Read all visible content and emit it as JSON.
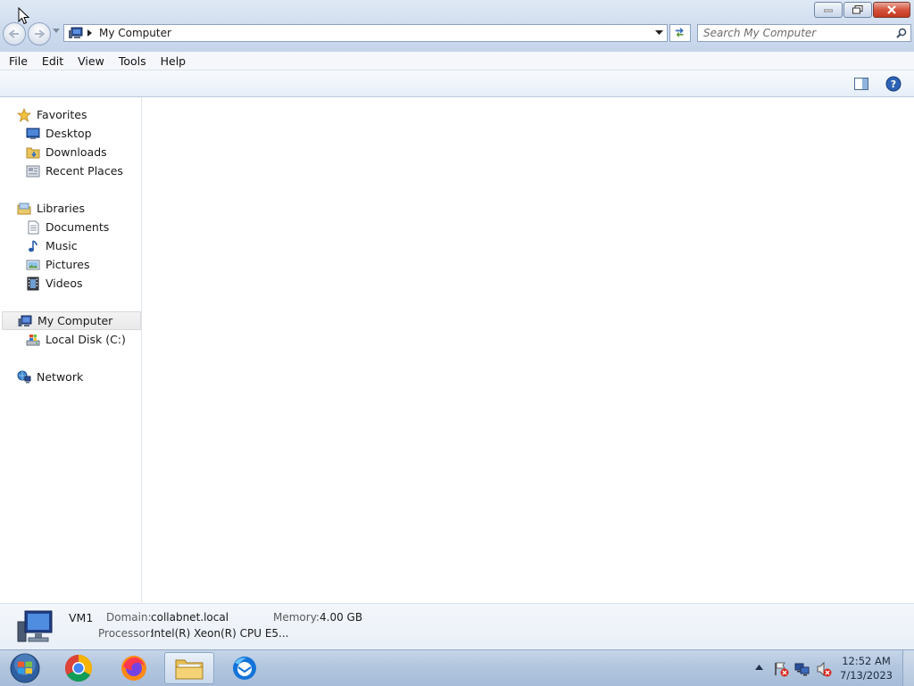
{
  "window": {
    "minimize_icon": "minimize-icon",
    "maximize_icon": "restore-icon",
    "close_icon": "close-icon"
  },
  "address_bar": {
    "path": "My Computer",
    "icon": "computer-icon"
  },
  "search": {
    "placeholder": "Search My Computer"
  },
  "menu": [
    "File",
    "Edit",
    "View",
    "Tools",
    "Help"
  ],
  "nav": {
    "favorites": {
      "label": "Favorites",
      "items": [
        "Desktop",
        "Downloads",
        "Recent Places"
      ]
    },
    "libraries": {
      "label": "Libraries",
      "items": [
        "Documents",
        "Music",
        "Pictures",
        "Videos"
      ]
    },
    "computer": {
      "label": "My Computer",
      "items": [
        "Local Disk (C:)"
      ]
    },
    "network": {
      "label": "Network"
    }
  },
  "details": {
    "name": "VM1",
    "domain_label": "Domain:",
    "domain_value": "collabnet.local",
    "memory_label": "Memory:",
    "memory_value": "4.00 GB",
    "processor_label": "Processor:",
    "processor_value": "Intel(R) Xeon(R) CPU E5..."
  },
  "taskbar": {
    "apps": [
      "start-orb",
      "chrome",
      "firefox",
      "windows-explorer",
      "thunderbird"
    ],
    "time": "12:52 AM",
    "date": "7/13/2023"
  },
  "colors": {
    "accent": "#c4d4ea",
    "close_button": "#c2381f",
    "selection": "#e9e9e9"
  }
}
